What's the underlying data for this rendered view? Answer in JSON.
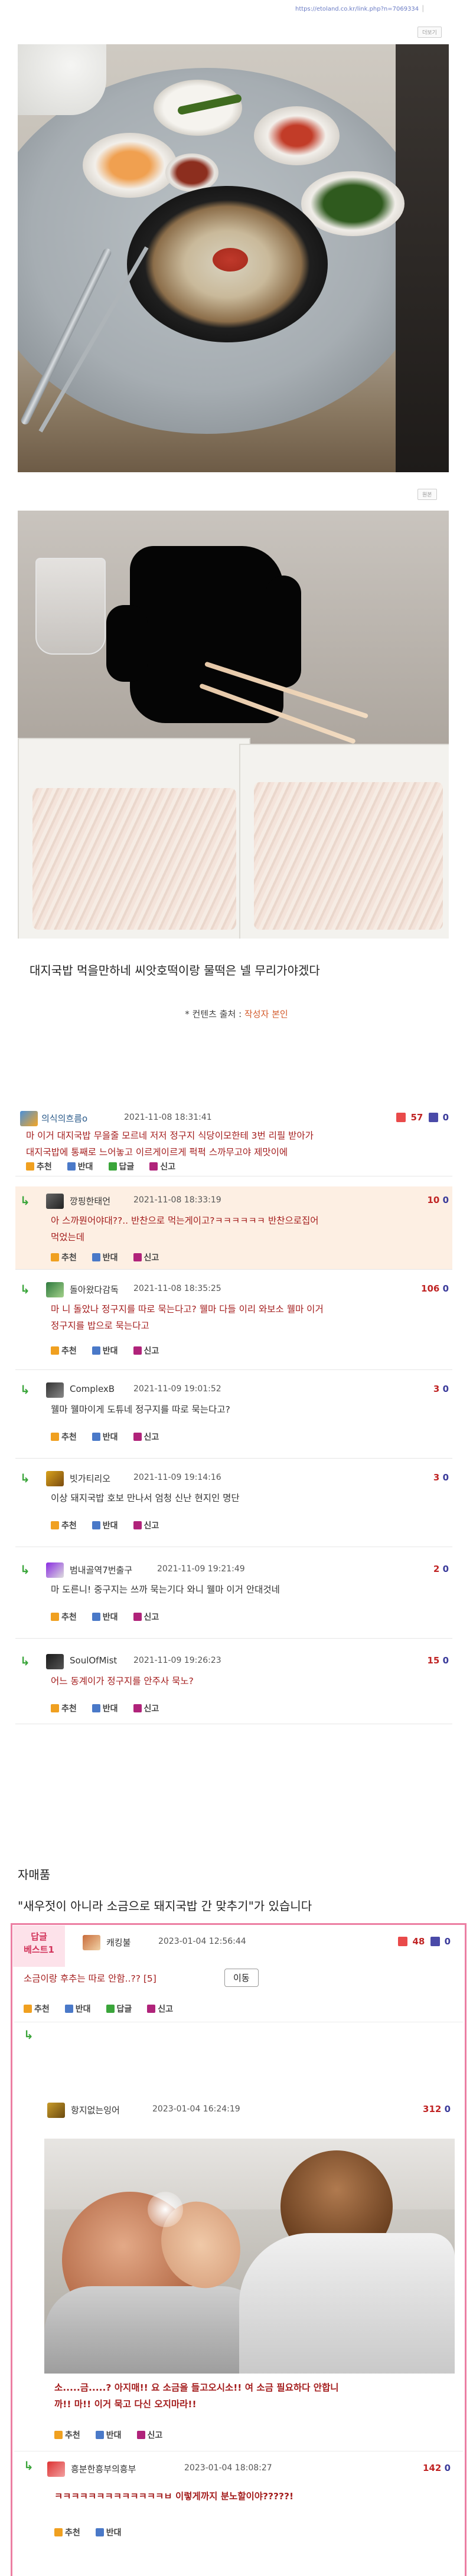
{
  "header": {
    "url": "https://etoland.co.kr/link.php?n=7069334",
    "share_label": "│"
  },
  "photo1": {
    "more_label": "더보기"
  },
  "photo2": {
    "original_label": "원본"
  },
  "post": {
    "caption": "대지국밥 먹을만하네 씨앗호떡이랑 물떡은 넬 무리가야겠다",
    "source_prefix": "* 컨텐츠 출처 : ",
    "source_value": "작성자 본인"
  },
  "actions": {
    "up": "추천",
    "down": "반대",
    "reply": "답글",
    "report": "신고"
  },
  "comments": [
    {
      "nick": "의식의흐름o",
      "date": "2021-11-08 18:31:41",
      "up": "57",
      "down": "0",
      "body1": "마 이거 대지국밥 무을줄 모르네 저저 정구지 식당이모한테 3번 리필 받아가",
      "body2": "대지국밥에 통째로 느어놓고 이르게이르게 퍽퍽 스까무고야 제맛이에"
    },
    {
      "nick": "깡핑한태언",
      "date": "2021-11-08 18:33:19",
      "up": "10",
      "down": "0",
      "body1": "아 스까뭔어야대??.. 반찬으로 먹는게이고?ㅋㅋㅋㅋㅋㅋ 반찬으로집어",
      "body2": "먹었는데"
    },
    {
      "nick": "돌아왔다감독",
      "date": "2021-11-08 18:35:25",
      "up": "106",
      "down": "0",
      "body1": "마 니 돌았나 정구지를 따로 묵는다고? 웰마 다들 이리 와보소 웰마 이거",
      "body2": "정구지를 밥으로 묵는다고"
    },
    {
      "nick": "ComplexB",
      "date": "2021-11-09 19:01:52",
      "up": "3",
      "down": "0",
      "body1": "웰마 웰마이게 도튜네 정구지를 따로 묵는다고?",
      "body2": ""
    },
    {
      "nick": "빗가티리오",
      "date": "2021-11-09 19:14:16",
      "up": "3",
      "down": "0",
      "body1": "이상 돼지국밥 호보 만나서 엄청 신난 현지인 명단",
      "body2": ""
    },
    {
      "nick": "범내골역7번출구",
      "date": "2021-11-09 19:21:49",
      "up": "2",
      "down": "0",
      "body1": "마 도른니! 중구지는 쓰까 묵는기다 와니 웰마 이거 안대것네",
      "body2": ""
    },
    {
      "nick": "SoulOfMist",
      "date": "2021-11-09 19:26:23",
      "up": "15",
      "down": "0",
      "body1": "어느 동계이가 정구지를 안주사 묵노?",
      "body2": ""
    }
  ],
  "self_reply": {
    "title": "자매품",
    "text": "\"새우젓이 아니라 소금으로 돼지국밥 간 맞추기\"가 있습니다"
  },
  "best": {
    "label1": "답글",
    "label2": "베스트1",
    "nick": "캐킹불",
    "date": "2023-01-04 12:56:44",
    "up": "48",
    "down": "0",
    "body": "소금이랑 후추는 따로 안함..?? [5]",
    "move_label": "이동"
  },
  "best_replies": [
    {
      "nick": "항지없는잉어",
      "date": "2023-01-04 16:24:19",
      "up": "312",
      "down": "0",
      "body1": "소.....금.....? 아지매!! 요 소금을 들고오시소!! 여 소금 필요하다 안합니",
      "body2": "까!! 마!! 이거 묵고 다신 오지마라!!"
    },
    {
      "nick": "흥분한흥부의흥부",
      "date": "2023-01-04 18:08:27",
      "up": "142",
      "down": "0",
      "body1": "ㅋㅋㅋㅋㅋㅋㅋㅋㅋㅋㅋㅋㅋㅂ 이렇게까지 분노할이야?????!",
      "body2": ""
    }
  ],
  "colors": {
    "red_text": "#a41d1d",
    "best_border": "#ec7fa3",
    "best_label_bg": "#fde2ea",
    "highlight_bg": "#fdefe3"
  }
}
